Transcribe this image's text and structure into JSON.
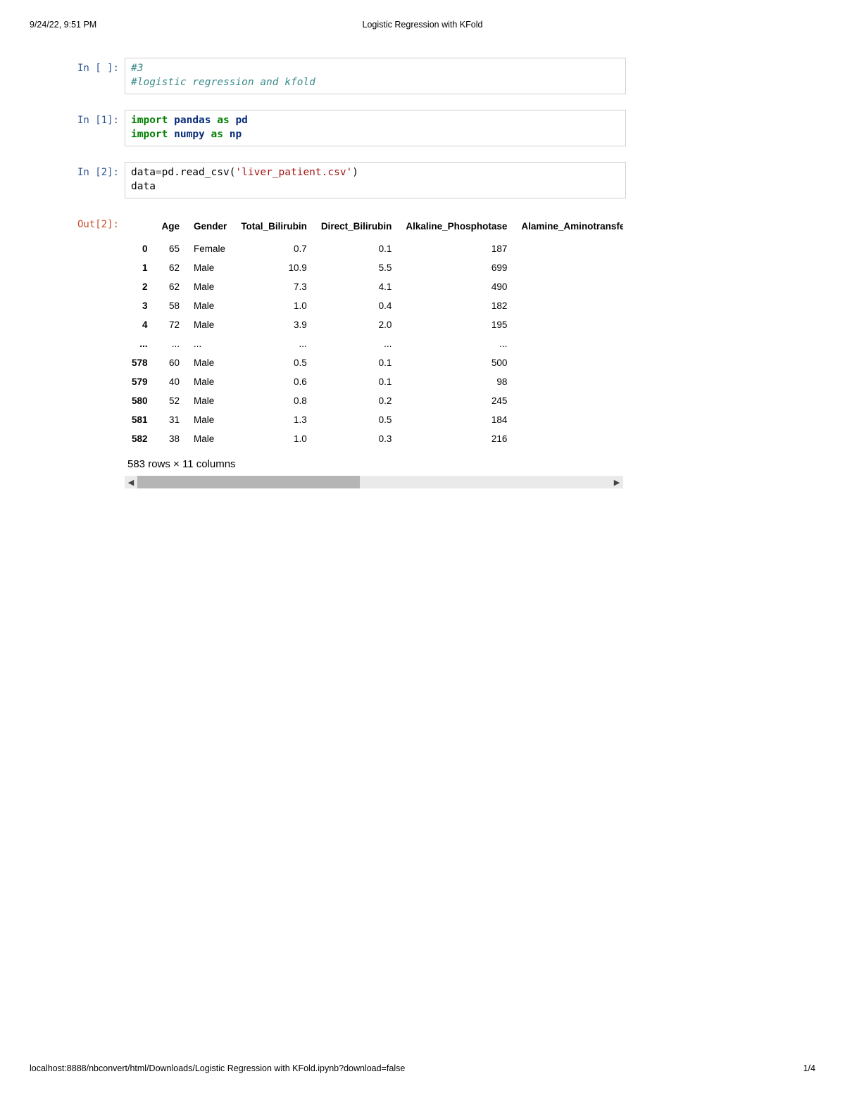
{
  "header": {
    "timestamp": "9/24/22, 9:51 PM",
    "title": "Logistic Regression with KFold"
  },
  "footer": {
    "url": "localhost:8888/nbconvert/html/Downloads/Logistic Regression with KFold.ipynb?download=false",
    "page": "1/4"
  },
  "cells": {
    "c0": {
      "prompt": "In [ ]:",
      "code": {
        "line1": "#3",
        "line2": "#logistic regression and kfold"
      }
    },
    "c1": {
      "prompt": "In [1]:",
      "code": {
        "kw_import": "import",
        "mod_pandas": "pandas",
        "kw_as": "as",
        "alias_pd": "pd",
        "mod_numpy": "numpy",
        "alias_np": "np"
      }
    },
    "c2": {
      "prompt": "In [2]:",
      "code": {
        "lhs": "data",
        "eq": "=",
        "call1": "pd.read_csv(",
        "str": "'liver_patient.csv'",
        "call2": ")",
        "line2": "data"
      }
    },
    "out2": {
      "prompt": "Out[2]:",
      "caption": "583 rows × 11 columns",
      "columns": [
        "",
        "Age",
        "Gender",
        "Total_Bilirubin",
        "Direct_Bilirubin",
        "Alkaline_Phosphotase",
        "Alamine_Aminotransfer"
      ],
      "rows": [
        {
          "idx": "0",
          "Age": "65",
          "Gender": "Female",
          "Total_Bilirubin": "0.7",
          "Direct_Bilirubin": "0.1",
          "Alkaline_Phosphotase": "187"
        },
        {
          "idx": "1",
          "Age": "62",
          "Gender": "Male",
          "Total_Bilirubin": "10.9",
          "Direct_Bilirubin": "5.5",
          "Alkaline_Phosphotase": "699"
        },
        {
          "idx": "2",
          "Age": "62",
          "Gender": "Male",
          "Total_Bilirubin": "7.3",
          "Direct_Bilirubin": "4.1",
          "Alkaline_Phosphotase": "490"
        },
        {
          "idx": "3",
          "Age": "58",
          "Gender": "Male",
          "Total_Bilirubin": "1.0",
          "Direct_Bilirubin": "0.4",
          "Alkaline_Phosphotase": "182"
        },
        {
          "idx": "4",
          "Age": "72",
          "Gender": "Male",
          "Total_Bilirubin": "3.9",
          "Direct_Bilirubin": "2.0",
          "Alkaline_Phosphotase": "195"
        },
        {
          "idx": "...",
          "Age": "...",
          "Gender": "...",
          "Total_Bilirubin": "...",
          "Direct_Bilirubin": "...",
          "Alkaline_Phosphotase": "..."
        },
        {
          "idx": "578",
          "Age": "60",
          "Gender": "Male",
          "Total_Bilirubin": "0.5",
          "Direct_Bilirubin": "0.1",
          "Alkaline_Phosphotase": "500"
        },
        {
          "idx": "579",
          "Age": "40",
          "Gender": "Male",
          "Total_Bilirubin": "0.6",
          "Direct_Bilirubin": "0.1",
          "Alkaline_Phosphotase": "98"
        },
        {
          "idx": "580",
          "Age": "52",
          "Gender": "Male",
          "Total_Bilirubin": "0.8",
          "Direct_Bilirubin": "0.2",
          "Alkaline_Phosphotase": "245"
        },
        {
          "idx": "581",
          "Age": "31",
          "Gender": "Male",
          "Total_Bilirubin": "1.3",
          "Direct_Bilirubin": "0.5",
          "Alkaline_Phosphotase": "184"
        },
        {
          "idx": "582",
          "Age": "38",
          "Gender": "Male",
          "Total_Bilirubin": "1.0",
          "Direct_Bilirubin": "0.3",
          "Alkaline_Phosphotase": "216"
        }
      ]
    }
  }
}
